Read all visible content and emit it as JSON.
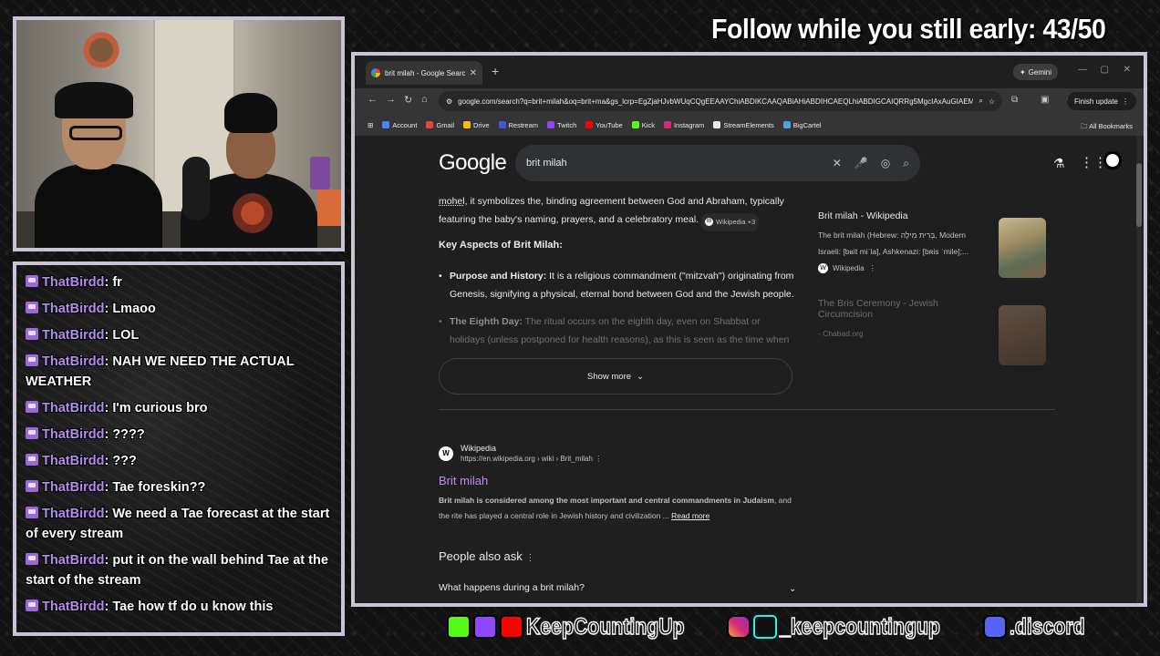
{
  "overlay": {
    "follow_goal": "Follow while you still early: 43/50"
  },
  "chat": {
    "messages": [
      {
        "user": "ThatBirdd",
        "text": "fr"
      },
      {
        "user": "ThatBirdd",
        "text": "Lmaoo"
      },
      {
        "user": "ThatBirdd",
        "text": "LOL"
      },
      {
        "user": "ThatBirdd",
        "text": "NAH WE NEED THE ACTUAL WEATHER"
      },
      {
        "user": "ThatBirdd",
        "text": "I'm curious bro"
      },
      {
        "user": "ThatBirdd",
        "text": "????"
      },
      {
        "user": "ThatBirdd",
        "text": "???"
      },
      {
        "user": "ThatBirdd",
        "text": "Tae foreskin??"
      },
      {
        "user": "ThatBirdd",
        "text": "We need a Tae forecast at the start of every stream"
      },
      {
        "user": "ThatBirdd",
        "text": "put it on the wall behind Tae at the start of the stream"
      },
      {
        "user": "ThatBirdd",
        "text": "Tae how tf do u know this"
      }
    ]
  },
  "socials": {
    "handle_main": "KeepCountingUp",
    "handle_social": "_keepcountingup",
    "discord": ".discord",
    "colors": {
      "kick": "#53fc18",
      "twitch": "#9146ff",
      "youtube": "#ff0000",
      "discord": "#5865f2"
    }
  },
  "browser": {
    "tab_title": "brit milah - Google Search",
    "new_tab": "+",
    "gemini": "Gemini",
    "url": "google.com/search?q=brit+milah&oq=brit+ma&gs_lcrp=EgZjaHJvbWUqCQgEEAAYChiABDIKCAAQABiAHiABDIHCAEQLhiABDIGCAIQRRg5MgcIAxAuGIAEMgcI...",
    "finish_update": "Finish update",
    "bookmarks": [
      {
        "label": "Account",
        "color": "#4285f4"
      },
      {
        "label": "Gmail",
        "color": "#ea4335"
      },
      {
        "label": "Drive",
        "color": "#fbbc05"
      },
      {
        "label": "Restream",
        "color": "#3b5bdb"
      },
      {
        "label": "Twitch",
        "color": "#9146ff"
      },
      {
        "label": "YouTube",
        "color": "#ff0000"
      },
      {
        "label": "Kick",
        "color": "#53fc18"
      },
      {
        "label": "Instagram",
        "color": "#d62976"
      },
      {
        "label": "StreamElements",
        "color": "#e8eaed"
      },
      {
        "label": "BigCartel",
        "color": "#4aa3df"
      }
    ],
    "all_bookmarks": "All Bookmarks"
  },
  "search": {
    "logo": "Google",
    "query": "brit milah",
    "overview": {
      "intro_link": "mohel",
      "intro_text": ", it symbolizes the, binding agreement between God and Abraham, typically featuring the baby's naming, prayers, and a celebratory meal.",
      "intro_chip": "Wikipedia +3",
      "heading": "Key Aspects of Brit Milah:",
      "bullets": [
        {
          "title": "Purpose and History:",
          "text": " It is a religious commandment (\"mitzvah\") originating from Genesis, signifying a physical, eternal bond between God and the Jewish people."
        },
        {
          "title": "The Eighth Day:",
          "text": " The ritual occurs on the eighth day, even on Shabbat or holidays (unless postponed for health reasons), as this is seen as the time when a child is"
        }
      ],
      "show_more": "Show more"
    },
    "side_sources": [
      {
        "title": "Brit milah - Wikipedia",
        "desc": "The brit milah (Hebrew: בְּרִית מִילָה, Modern Israeli: [bʁit miˈla], Ashkenazi: [bʀis ˈmile];...",
        "source": "Wikipedia"
      },
      {
        "title": "The Bris Ceremony - Jewish Circumcision",
        "desc": "- Chabad.org",
        "source": ""
      }
    ],
    "result": {
      "site": "Wikipedia",
      "url": "https://en.wikipedia.org › wiki › Brit_milah",
      "title": "Brit milah",
      "snippet_bold": "Brit milah is considered among the most important and central commandments in Judaism",
      "snippet_rest": ", and the rite has played a central role in Jewish history and civilization ...",
      "read_more": "Read more"
    },
    "people_also_ask": {
      "heading": "People also ask",
      "question": "What happens during a brit milah?"
    }
  }
}
